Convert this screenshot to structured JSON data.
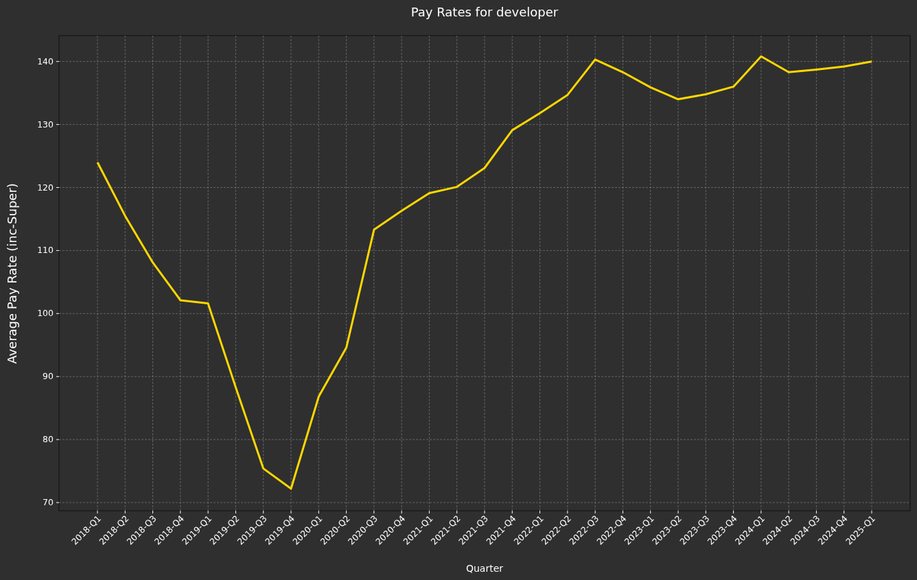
{
  "chart": {
    "chart_data": {
      "type": "line",
      "title": "Pay Rates for developer",
      "xlabel": "Quarter",
      "ylabel": "Average Pay Rate (inc-Super)",
      "categories": [
        "2018-Q1",
        "2018-Q2",
        "2018-Q3",
        "2018-Q4",
        "2019-Q1",
        "2019-Q2",
        "2019-Q3",
        "2019-Q4",
        "2020-Q1",
        "2020-Q2",
        "2020-Q3",
        "2020-Q4",
        "2021-Q1",
        "2021-Q2",
        "2021-Q3",
        "2021-Q4",
        "2022-Q1",
        "2022-Q2",
        "2022-Q3",
        "2022-Q4",
        "2023-Q1",
        "2023-Q2",
        "2023-Q3",
        "2023-Q4",
        "2024-Q1",
        "2024-Q2",
        "2024-Q3",
        "2024-Q4",
        "2025-Q1"
      ],
      "grid": true,
      "series": [
        {
          "color": "#ffd700",
          "values": [
            124.0,
            115.5,
            108.1,
            102.1,
            101.6,
            88.3,
            75.4,
            72.2,
            86.8,
            94.6,
            113.3,
            116.3,
            119.1,
            120.1,
            123.1,
            129.1,
            131.8,
            134.7,
            140.3,
            138.3,
            135.9,
            134.0,
            134.8,
            136.0,
            140.8,
            138.3,
            138.7,
            139.2,
            140.0
          ]
        }
      ],
      "ylim": [
        68.7,
        144.1
      ],
      "yticks": [
        70,
        80,
        90,
        100,
        110,
        120,
        130,
        140
      ]
    }
  }
}
